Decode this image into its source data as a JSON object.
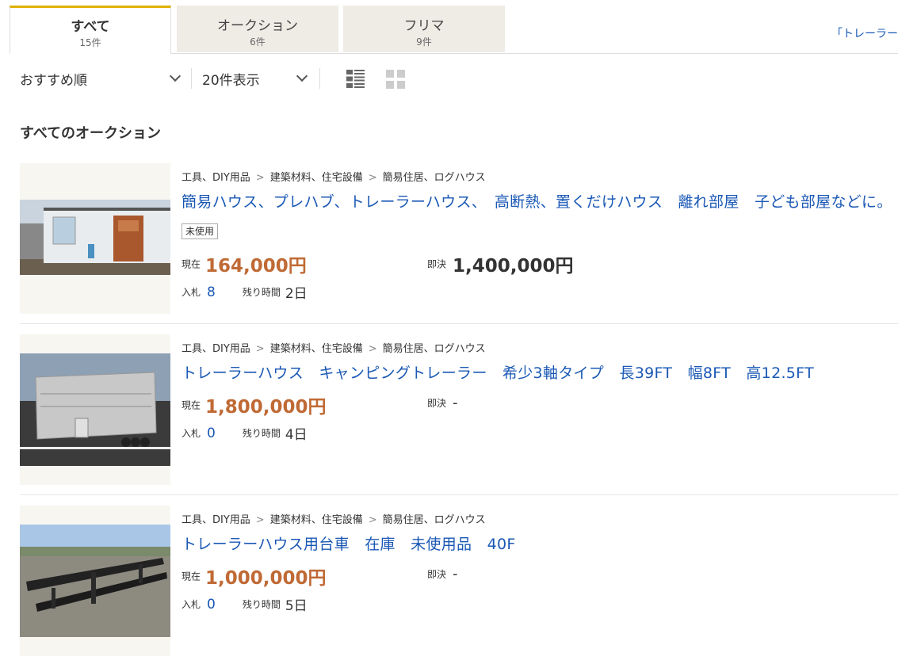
{
  "tabs": [
    {
      "label": "すべて",
      "count": "15件"
    },
    {
      "label": "オークション",
      "count": "6件"
    },
    {
      "label": "フリマ",
      "count": "9件"
    }
  ],
  "tab_link": "「トレーラー",
  "toolbar": {
    "sort": "おすすめ順",
    "per_page": "20件表示"
  },
  "section_title": "すべてのオークション",
  "labels": {
    "current": "現在",
    "bin": "即決",
    "bids": "入札",
    "remaining": "残り時間"
  },
  "items": [
    {
      "breadcrumb": [
        "工具、DIY用品",
        "建築材料、住宅設備",
        "簡易住居、ログハウス"
      ],
      "title": "簡易ハウス、プレハブ、トレーラーハウス、　高断熱、置くだけハウス　離れ部屋　子ども部屋などに。",
      "badge": "未使用",
      "current_price": "164,000円",
      "bin_price": "1,400,000円",
      "bids": "8",
      "remaining": "2日"
    },
    {
      "breadcrumb": [
        "工具、DIY用品",
        "建築材料、住宅設備",
        "簡易住居、ログハウス"
      ],
      "title": "トレーラーハウス　キャンピングトレーラー　希少3軸タイプ　長39FT　幅8FT　高12.5FT",
      "current_price": "1,800,000円",
      "bin_price": "-",
      "bids": "0",
      "remaining": "4日"
    },
    {
      "breadcrumb": [
        "工具、DIY用品",
        "建築材料、住宅設備",
        "簡易住居、ログハウス"
      ],
      "title": "トレーラーハウス用台車　在庫　未使用品　40F",
      "current_price": "1,000,000円",
      "bin_price": "-",
      "bids": "0",
      "remaining": "5日"
    }
  ],
  "colors": {
    "link": "#1a58b5",
    "price": "#c06a35",
    "tab_accent": "#e0b000",
    "tab_bg": "#efece6"
  },
  "icons": {
    "sort_chevron": "chevron-down-icon",
    "list_view": "list-view-icon",
    "grid_view": "grid-view-icon"
  }
}
